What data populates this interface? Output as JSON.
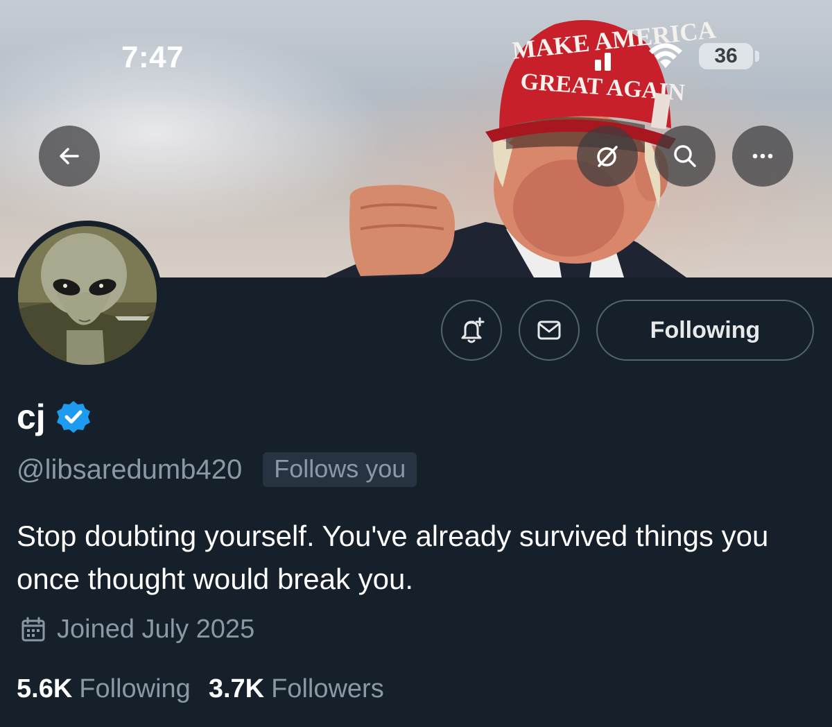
{
  "status_bar": {
    "time": "7:47",
    "battery": "36"
  },
  "banner": {
    "hat_text_line1": "MAKE AMERICA",
    "hat_text_line2": "GREAT AGAIN"
  },
  "toolbar": {
    "back_icon": "arrow-left-icon",
    "grok_icon": "grok-icon",
    "search_icon": "search-icon",
    "more_icon": "more-horizontal-icon"
  },
  "actions": {
    "notify_icon": "bell-plus-icon",
    "message_icon": "mail-icon",
    "following_label": "Following"
  },
  "profile": {
    "display_name": "cj",
    "verified": true,
    "handle": "@libsaredumb420",
    "follows_you": "Follows you",
    "bio": "Stop doubting yourself. You've already survived things you once thought would break you.",
    "joined": "Joined July 2025"
  },
  "stats": {
    "following_count": "5.6K",
    "following_label": "Following",
    "followers_count": "3.7K",
    "followers_label": "Followers"
  },
  "colors": {
    "background": "#15202b",
    "muted_text": "#8b98a5",
    "verified_blue": "#1d9bf0",
    "border": "#536471"
  }
}
